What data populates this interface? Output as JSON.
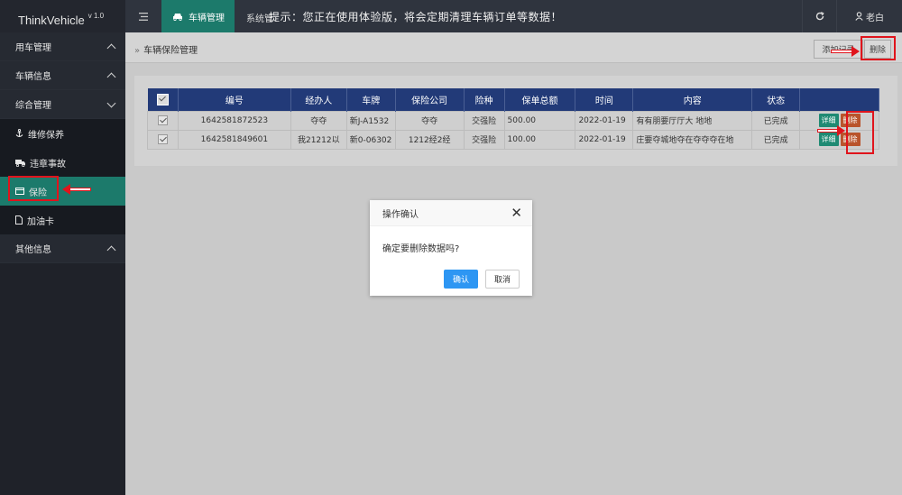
{
  "app": {
    "name": "ThinkVehicle",
    "version": "v 1.0"
  },
  "topbar": {
    "active_tab": "车辆管理",
    "tab_2": "系统管",
    "notice": "提示：您正在使用体验版，将会定期清理车辆订单等数据！",
    "user": "老白"
  },
  "sidebar": {
    "groups": [
      {
        "label": "用车管理"
      },
      {
        "label": "车辆信息"
      },
      {
        "label": "综合管理"
      },
      {
        "label": "其他信息"
      }
    ],
    "subitems": [
      {
        "label": "维修保养",
        "icon": "anchor-icon"
      },
      {
        "label": "违章事故",
        "icon": "truck-icon"
      },
      {
        "label": "保险",
        "icon": "card-icon"
      },
      {
        "label": "加油卡",
        "icon": "file-icon"
      }
    ]
  },
  "content": {
    "breadcrumb": "车辆保险管理",
    "add_button": "添加记录",
    "delete_button": "删除"
  },
  "table": {
    "headers": [
      "编号",
      "经办人",
      "车牌",
      "保险公司",
      "险种",
      "保单总额",
      "时间",
      "内容",
      "状态",
      ""
    ],
    "rows": [
      {
        "id": "1642581872523",
        "handler": "夺夺",
        "plate": "新J-A1532",
        "company": "夺夺",
        "type": "交强险",
        "amount": "500.00",
        "time": "2022-01-19",
        "content": "有有朋要厅厅大 地地",
        "status": "已完成",
        "detail": "详细",
        "delete": "删除"
      },
      {
        "id": "1642581849601",
        "handler": "我21212以",
        "plate": "新0-06302",
        "company": "1212经2经",
        "type": "交强险",
        "amount": "100.00",
        "time": "2022-01-19",
        "content": "庄要夺城地夺在夺夺夺在地",
        "status": "已完成",
        "detail": "详细",
        "delete": "删除"
      }
    ]
  },
  "modal": {
    "title": "操作确认",
    "message": "确定要删除数据吗?",
    "ok": "确认",
    "cancel": "取消"
  },
  "colors": {
    "accent": "#1c7a6b",
    "header_bg": "#223a78",
    "annotation": "#e0141c"
  }
}
